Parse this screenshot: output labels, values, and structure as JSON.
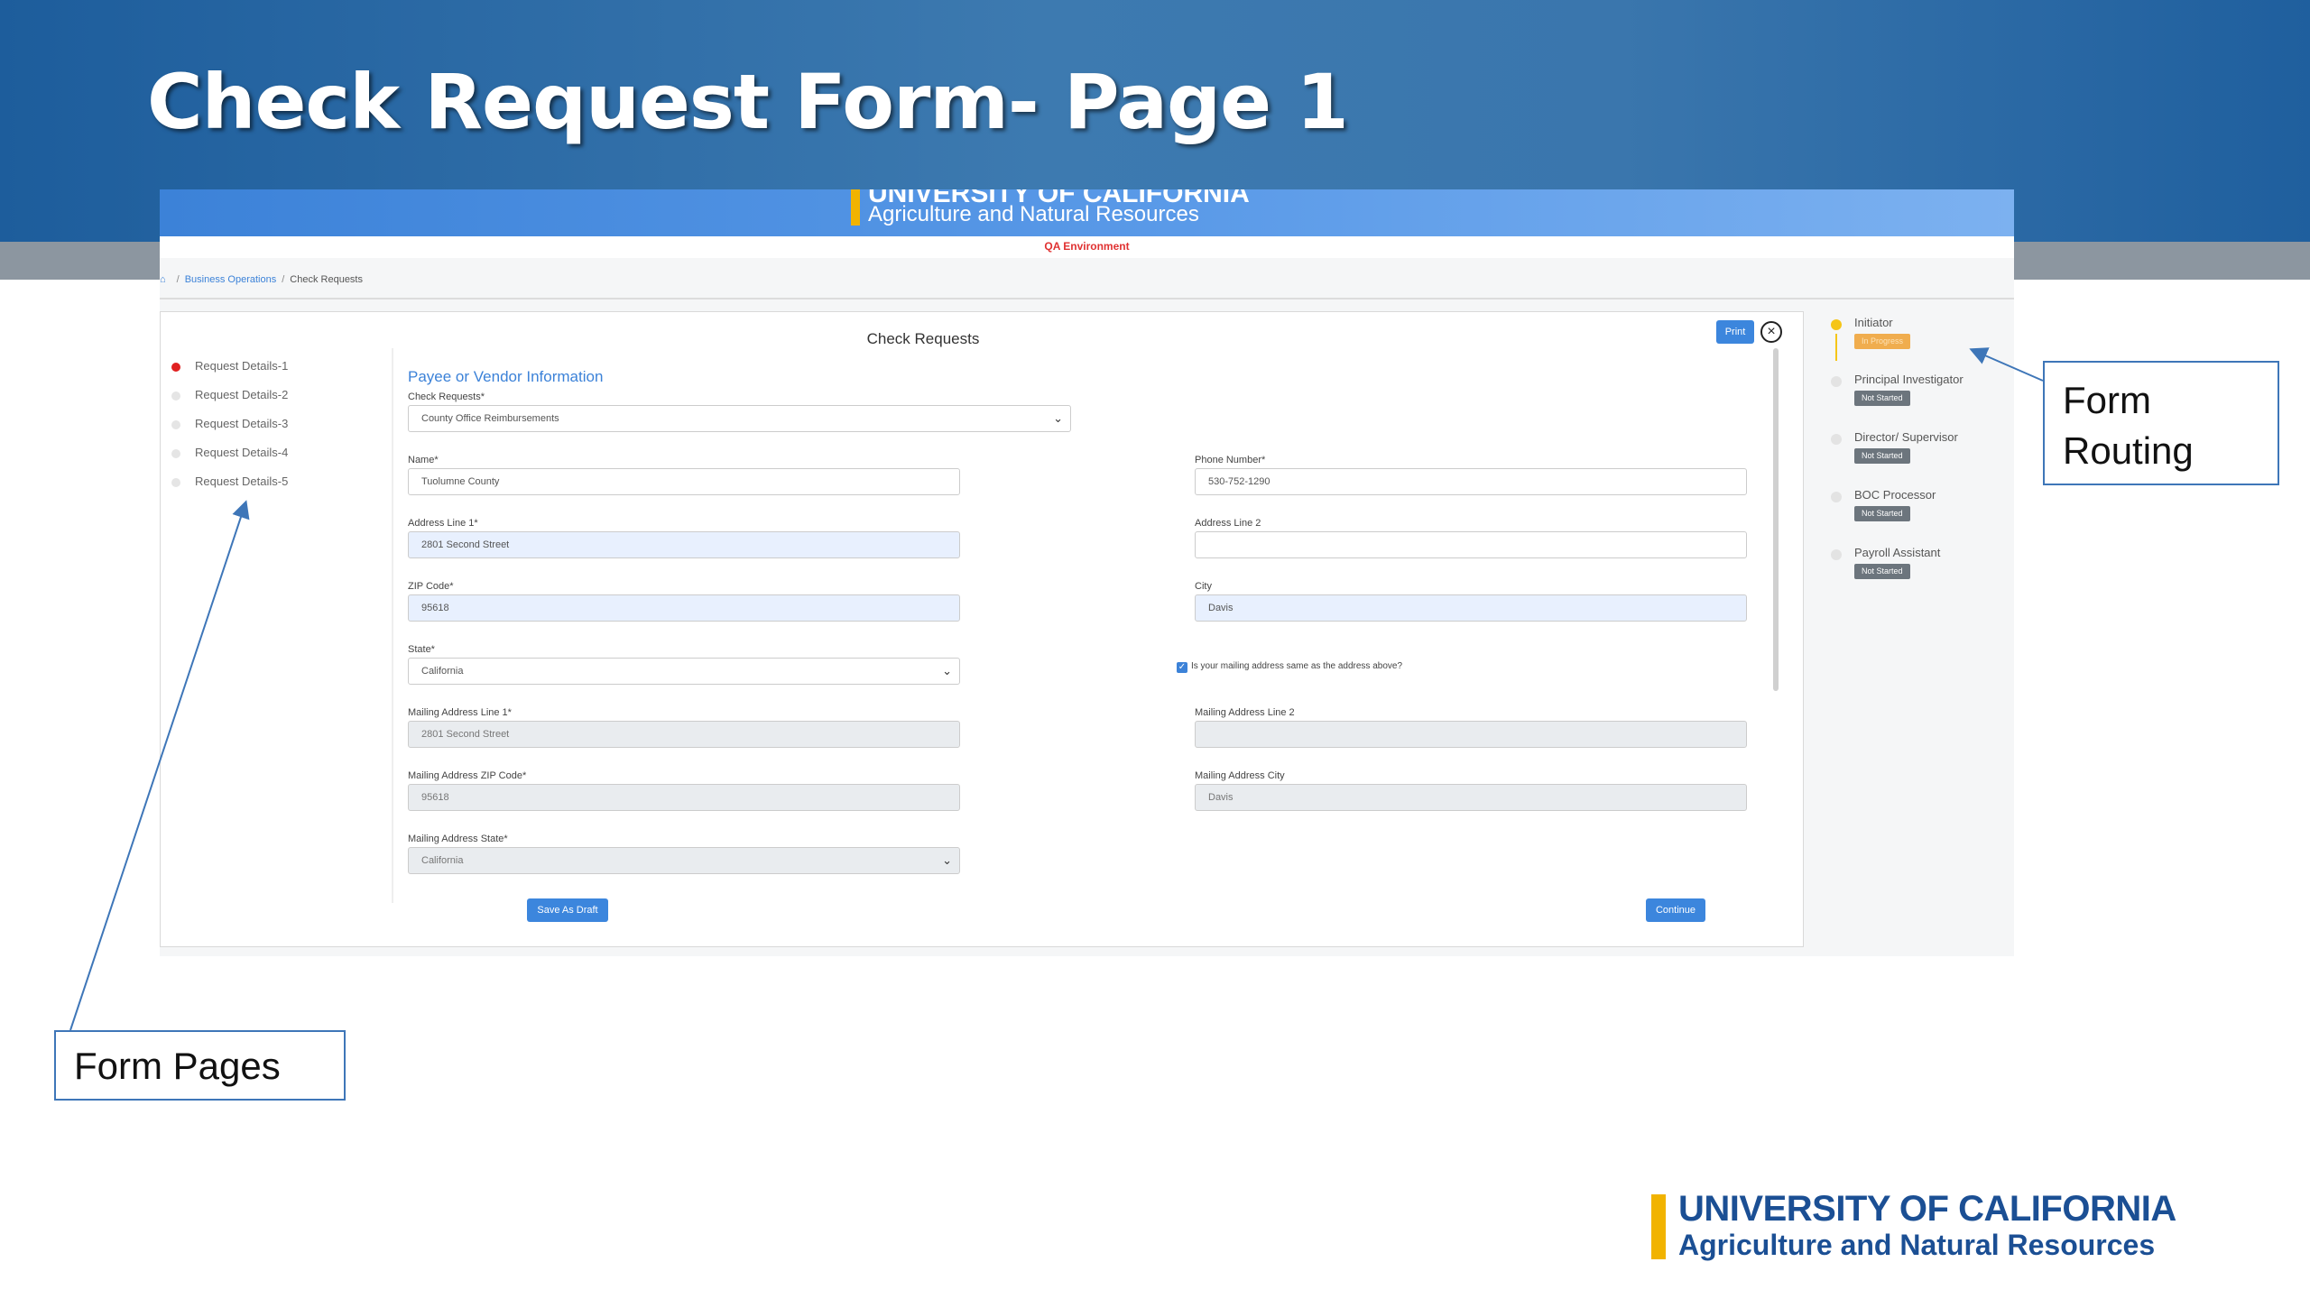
{
  "slide": {
    "title": "Check Request Form- Page 1"
  },
  "app": {
    "header": {
      "line1": "UNIVERSITY OF CALIFORNIA",
      "line2": "Agriculture and Natural Resources"
    },
    "environment": "QA Environment",
    "breadcrumb": {
      "home_icon": "home-icon",
      "items": [
        "Business Operations",
        "Check Requests"
      ]
    },
    "panel": {
      "title": "Check Requests",
      "print_label": "Print",
      "close_icon": "close-icon"
    },
    "pages": [
      {
        "label": "Request Details-1",
        "active": true
      },
      {
        "label": "Request Details-2",
        "active": false
      },
      {
        "label": "Request Details-3",
        "active": false
      },
      {
        "label": "Request Details-4",
        "active": false
      },
      {
        "label": "Request Details-5",
        "active": false
      }
    ],
    "form": {
      "section_title": "Payee or Vendor Information",
      "check_requests": {
        "label": "Check Requests*",
        "value": "County Office Reimbursements"
      },
      "name": {
        "label": "Name*",
        "value": "Tuolumne County"
      },
      "phone": {
        "label": "Phone Number*",
        "value": "530-752-1290"
      },
      "address1": {
        "label": "Address Line 1*",
        "value": "2801 Second Street"
      },
      "address2": {
        "label": "Address Line 2",
        "value": ""
      },
      "zip": {
        "label": "ZIP Code*",
        "value": "95618"
      },
      "city": {
        "label": "City",
        "value": "Davis"
      },
      "state": {
        "label": "State*",
        "value": "California"
      },
      "same_address": {
        "label": "Is your mailing address same as the address above?",
        "checked": true
      },
      "mail_address1": {
        "label": "Mailing Address Line 1*",
        "value": "2801 Second Street"
      },
      "mail_address2": {
        "label": "Mailing Address Line 2",
        "value": ""
      },
      "mail_zip": {
        "label": "Mailing Address ZIP Code*",
        "value": "95618"
      },
      "mail_city": {
        "label": "Mailing Address City",
        "value": "Davis"
      },
      "mail_state": {
        "label": "Mailing Address State*",
        "value": "California"
      },
      "save_draft_label": "Save As Draft",
      "continue_label": "Continue"
    },
    "routing": [
      {
        "name": "Initiator",
        "status": "In Progress",
        "current": true
      },
      {
        "name": "Principal Investigator",
        "status": "Not Started",
        "current": false
      },
      {
        "name": "Director/ Supervisor",
        "status": "Not Started",
        "current": false
      },
      {
        "name": "BOC Processor",
        "status": "Not Started",
        "current": false
      },
      {
        "name": "Payroll Assistant",
        "status": "Not Started",
        "current": false
      }
    ]
  },
  "callouts": {
    "routing": "Form Routing",
    "pages": "Form Pages"
  },
  "footer_logo": {
    "line1": "UNIVERSITY OF CALIFORNIA",
    "line2": "Agriculture and Natural Resources"
  },
  "colors": {
    "banner_blue": "#3d7ab0",
    "ucanr_gold": "#f1b300",
    "ucanr_navy": "#1b4f94",
    "app_accent": "#3c82d8",
    "active_page": "#e02020",
    "env_red": "#e03131"
  }
}
